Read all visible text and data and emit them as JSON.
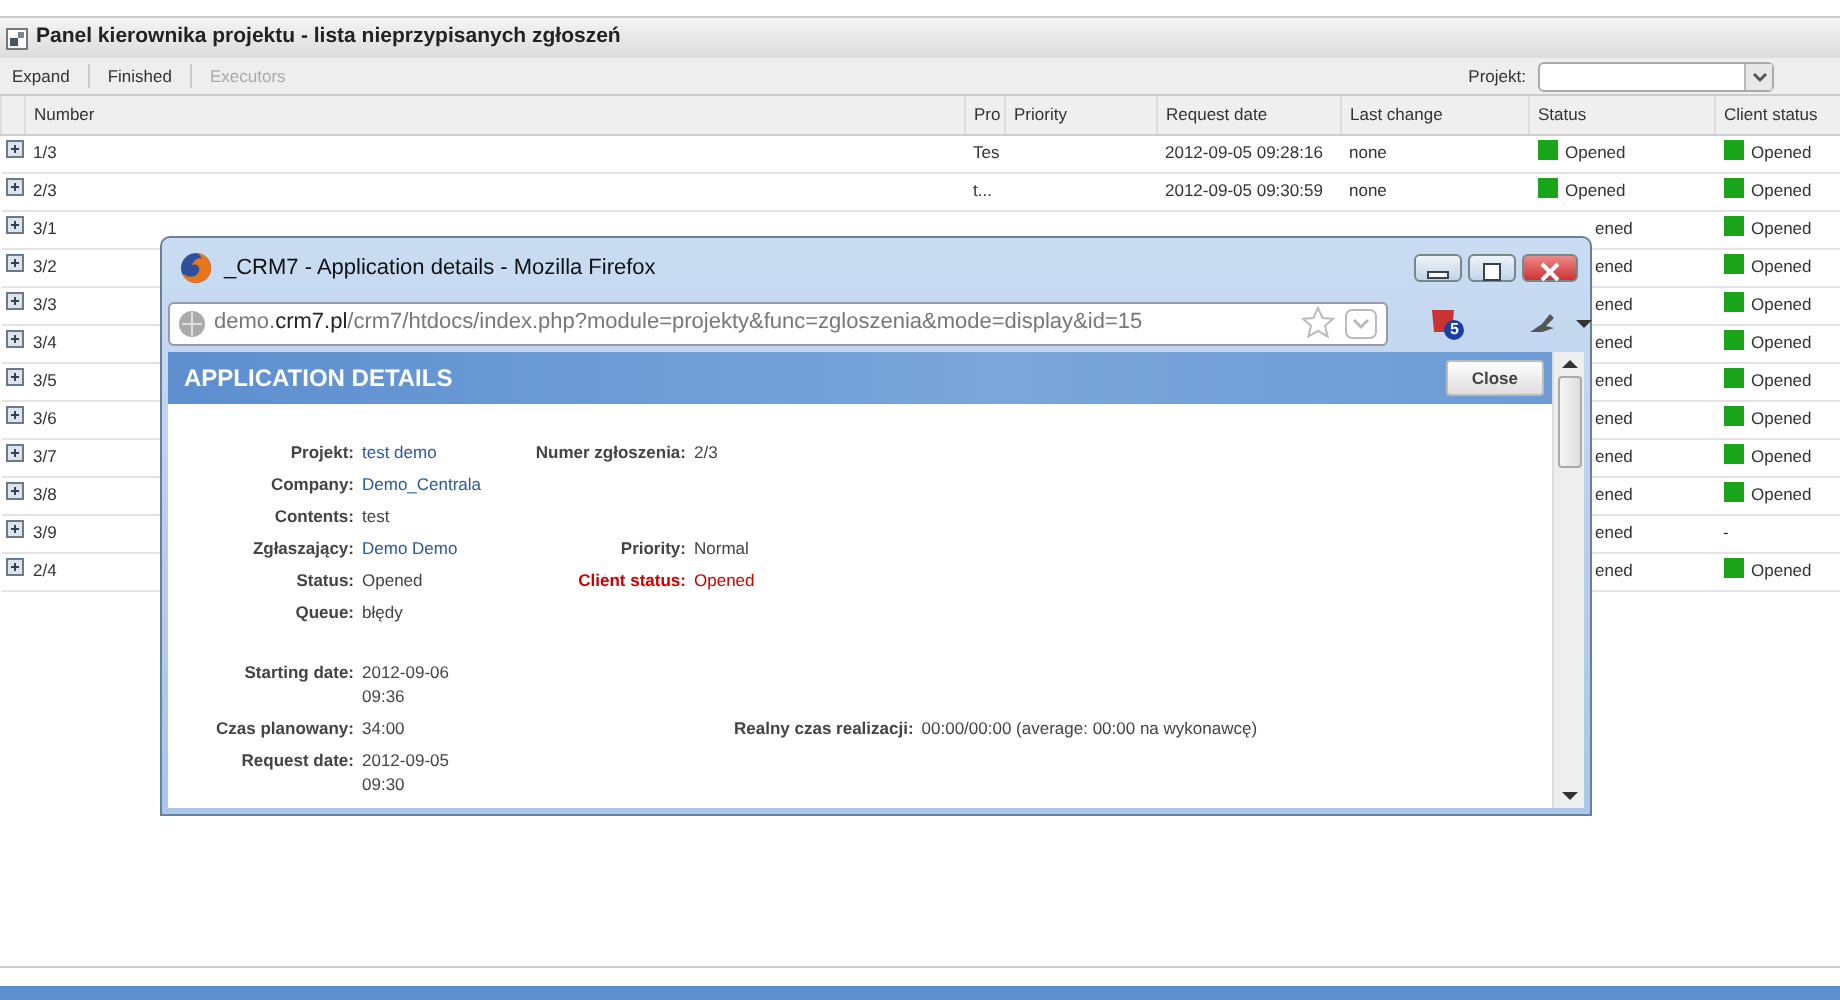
{
  "panel": {
    "title": "Panel kierownika projektu - lista nieprzypisanych zgłoszeń"
  },
  "toolbar": {
    "items": [
      {
        "label": "Expand",
        "disabled": false
      },
      {
        "label": "Finished",
        "disabled": false
      },
      {
        "label": "Executors",
        "disabled": true
      }
    ],
    "project_label": "Projekt:"
  },
  "table": {
    "columns": [
      "Number",
      "Pro",
      "Priority",
      "Request date",
      "Last change",
      "Status",
      "Client status"
    ],
    "rows": [
      {
        "kind": "full",
        "number": "1/3",
        "project": "Tes",
        "request_date": "2012-09-05 09:28:16",
        "last_change": "none",
        "status": {
          "text": "Opened",
          "color": "#1aa41a"
        },
        "client_status": {
          "text": "Opened",
          "color": "#1aa41a"
        }
      },
      {
        "kind": "full",
        "number": "2/3",
        "project": "t...",
        "request_date": "2012-09-05 09:30:59",
        "last_change": "none",
        "status": {
          "text": "Opened",
          "color": "#1aa41a"
        },
        "client_status": {
          "text": "Opened",
          "color": "#1aa41a"
        }
      },
      {
        "kind": "covered",
        "number": "3/1",
        "status": {
          "text": "ened"
        },
        "client_status": {
          "text": "Opened",
          "color": "#1aa41a"
        }
      },
      {
        "kind": "covered",
        "number": "3/2",
        "status": {
          "text": "ened"
        },
        "client_status": {
          "text": "Opened",
          "color": "#1aa41a"
        }
      },
      {
        "kind": "covered",
        "number": "3/3",
        "status": {
          "text": "ened"
        },
        "client_status": {
          "text": "Opened",
          "color": "#1aa41a"
        }
      },
      {
        "kind": "covered",
        "number": "3/4",
        "status": {
          "text": "ened"
        },
        "client_status": {
          "text": "Opened",
          "color": "#1aa41a"
        }
      },
      {
        "kind": "covered",
        "number": "3/5",
        "status": {
          "text": "ened"
        },
        "client_status": {
          "text": "Opened",
          "color": "#1aa41a"
        }
      },
      {
        "kind": "covered",
        "number": "3/6",
        "status": {
          "text": "ened"
        },
        "client_status": {
          "text": "Opened",
          "color": "#1aa41a"
        }
      },
      {
        "kind": "covered",
        "number": "3/7",
        "status": {
          "text": "ened"
        },
        "client_status": {
          "text": "Opened",
          "color": "#1aa41a"
        }
      },
      {
        "kind": "covered",
        "number": "3/8",
        "status": {
          "text": "ened"
        },
        "client_status": {
          "text": "Opened",
          "color": "#1aa41a"
        }
      },
      {
        "kind": "covered",
        "number": "3/9",
        "status": {
          "text": "ened"
        },
        "client_status": {
          "text": "-"
        }
      },
      {
        "kind": "covered",
        "number": "2/4",
        "status": {
          "text": "ened"
        },
        "client_status": {
          "text": "Opened",
          "color": "#1aa41a"
        }
      }
    ]
  },
  "popup": {
    "window_title": "_CRM7 - Application details - Mozilla Firefox",
    "url": {
      "host_prefix": "demo.",
      "domain": "crm7.pl",
      "path": "/crm7/htdocs/index.php?module=projekty&func=zgloszenia&mode=display&id=15"
    },
    "addon_badge": "5",
    "header": "APPLICATION DETAILS",
    "close_button": "Close",
    "rows": [
      {
        "left": {
          "label": "Projekt:",
          "value": "test demo",
          "kind": "link"
        },
        "right": {
          "label": "Numer zgłoszenia:",
          "value": "2/3",
          "kind": "text"
        }
      },
      {
        "left": {
          "label": "Company:",
          "value": "Demo_Centrala",
          "kind": "link"
        }
      },
      {
        "left": {
          "label": "Contents:",
          "value": "test",
          "kind": "text"
        }
      },
      {
        "left": {
          "label": "Zgłaszający:",
          "value": "Demo Demo",
          "kind": "link"
        },
        "right": {
          "label": "Priority:",
          "value": "Normal",
          "kind": "text"
        }
      },
      {
        "left": {
          "label": "Status:",
          "value": "Opened",
          "kind": "text"
        },
        "right": {
          "label": "Client status:",
          "value": "Opened",
          "kind": "alert"
        }
      },
      {
        "left": {
          "label": "Queue:",
          "value": "błędy",
          "kind": "text"
        }
      },
      {
        "left": {
          "label": "Starting date:",
          "value": "2012-09-06 09:36",
          "kind": "text"
        },
        "kind": "spaced"
      },
      {
        "left": {
          "label": "Czas planowany:",
          "value": "34:00",
          "kind": "text"
        },
        "far_right": {
          "label": "Realny czas realizacji:",
          "value": "00:00/00:00 (average: 00:00 na wykonawcę)"
        }
      },
      {
        "left": {
          "label": "Request date:",
          "value": "2012-09-05 09:30",
          "kind": "text"
        }
      }
    ]
  }
}
